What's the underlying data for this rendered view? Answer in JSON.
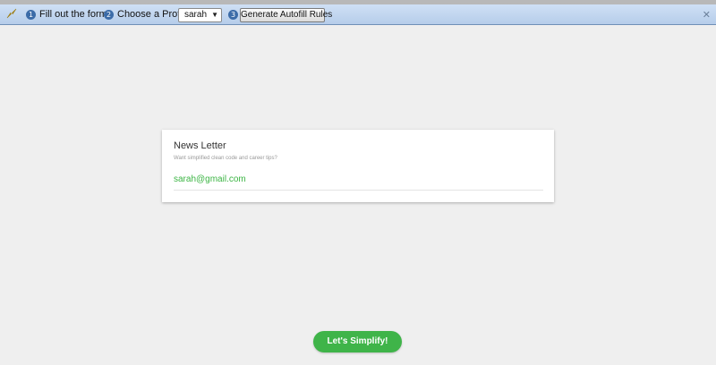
{
  "toolbar": {
    "logo_icon": "lightning-bolt-icon",
    "steps": [
      {
        "number": "1",
        "text": "Fill out the form."
      },
      {
        "number": "2",
        "text": "Choose a Profile:"
      },
      {
        "number": "3",
        "text": ""
      }
    ],
    "profile_select": {
      "selected": "sarah"
    },
    "generate_button_label": "Generate Autofill Rules",
    "close_icon": "close-icon"
  },
  "card": {
    "title": "News Letter",
    "subtitle": "Want simplified clean code and career tips?",
    "email_value": "sarah@gmail.com"
  },
  "simplify_button_label": "Let's Simplify!",
  "colors": {
    "accent_green": "#3fb449",
    "toolbar_blue": "#b6cdea",
    "step_badge": "#3c6ca8"
  }
}
